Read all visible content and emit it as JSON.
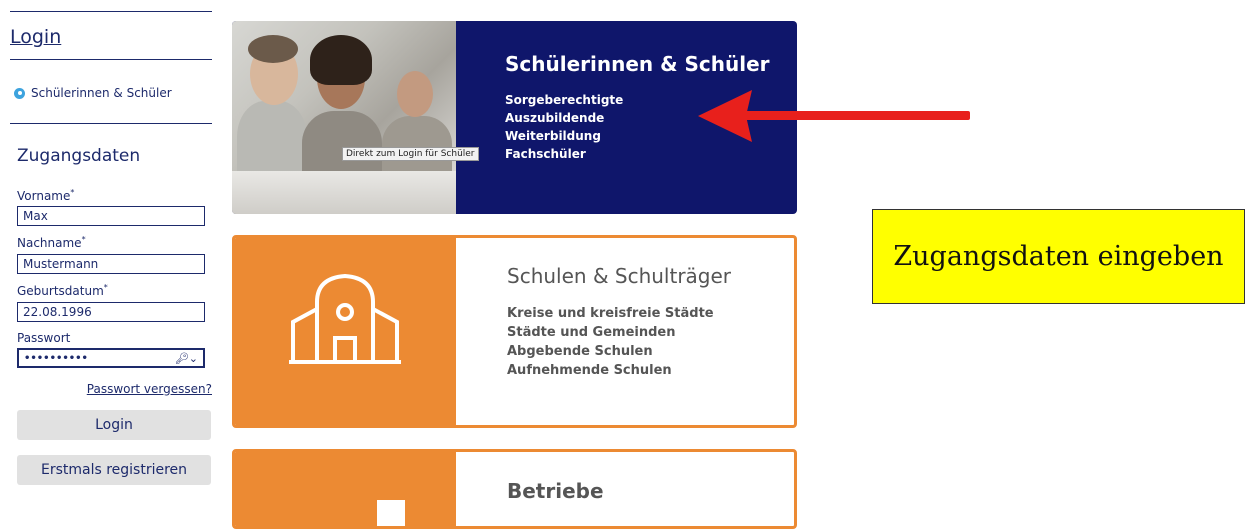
{
  "sidebar": {
    "login_link": "Login",
    "role_selected": "Schülerinnen & Schüler",
    "section_title": "Zugangsdaten",
    "fields": [
      {
        "label": "Vorname",
        "required": "*",
        "value": "Max"
      },
      {
        "label": "Nachname",
        "required": "*",
        "value": "Mustermann"
      },
      {
        "label": "Geburtsdatum",
        "required": "*",
        "value": "22.08.1996"
      },
      {
        "label": "Passwort",
        "required": "",
        "value": "••••••••••"
      }
    ],
    "forgot_password": "Passwort vergessen?",
    "login_button": "Login",
    "register_button": "Erstmals registrieren"
  },
  "cards": {
    "students": {
      "title": "Schülerinnen & Schüler",
      "items": [
        "Sorgeberechtigte",
        "Auszubildende",
        "Weiterbildung",
        "Fachschüler"
      ],
      "tooltip": "Direkt zum Login für Schüler"
    },
    "schools": {
      "title": "Schulen & Schulträger",
      "items": [
        "Kreise und kreisfreie Städte",
        "Städte und Gemeinden",
        "Abgebende Schulen",
        "Aufnehmende Schulen"
      ]
    },
    "companies": {
      "title": "Betriebe"
    }
  },
  "annotation": {
    "callout_text": "Zugangsdaten eingeben"
  },
  "colors": {
    "navy": "#0f166b",
    "orange": "#ec8a33",
    "callout_yellow": "#ffff00",
    "arrow_red": "#e8201c"
  },
  "icons": [
    "radio-selected-icon",
    "key-icon",
    "school-building-icon",
    "red-arrow"
  ]
}
